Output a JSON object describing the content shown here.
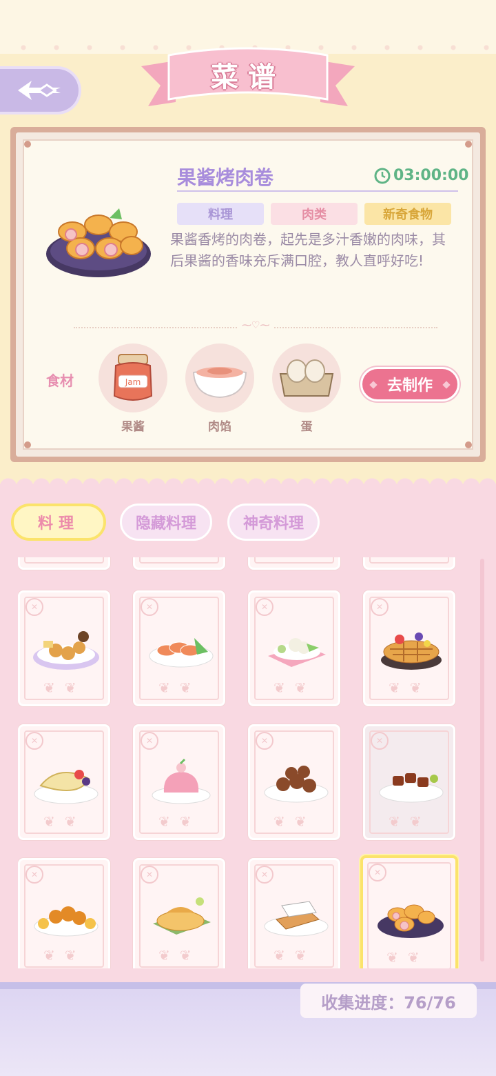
{
  "header": {
    "title": "菜谱",
    "back_icon": "back-arrow-icon"
  },
  "detail": {
    "dish_name": "果酱烤肉卷",
    "timer": "03:00:00",
    "tags": [
      "料理",
      "肉类",
      "新奇食物"
    ],
    "description": "果酱香烤的肉卷，起先是多汁香嫩的肉味，其后果酱的香味充斥满口腔，教人直呼好吃!",
    "ingredients_label": "食材",
    "ingredients": [
      {
        "name": "果酱",
        "icon": "jam-jar-icon",
        "jar_text": "Jam"
      },
      {
        "name": "肉馅",
        "icon": "meat-filling-icon"
      },
      {
        "name": "蛋",
        "icon": "egg-carton-icon"
      }
    ],
    "make_button": "去制作"
  },
  "tabs": [
    "料理",
    "隐藏料理",
    "神奇料理"
  ],
  "active_tab": "料理",
  "recipe_cards": [
    {
      "icon": "nuggets-platter-icon"
    },
    {
      "icon": "salmon-sashimi-icon"
    },
    {
      "icon": "cauliflower-salad-icon"
    },
    {
      "icon": "fruit-pie-icon"
    },
    {
      "icon": "taco-icon"
    },
    {
      "icon": "pink-jelly-icon"
    },
    {
      "icon": "meatballs-icon"
    },
    {
      "icon": "braised-pork-icon"
    },
    {
      "icon": "orange-chicken-icon"
    },
    {
      "icon": "fish-pie-icon"
    },
    {
      "icon": "toast-icon"
    },
    {
      "icon": "meat-roll-icon",
      "selected": true
    }
  ],
  "footer": {
    "progress_label": "收集进度：76/76"
  },
  "colors": {
    "accent_pink": "#ec7390",
    "lavender": "#a88ddc",
    "timer_green": "#5fb486",
    "tab_yellow": "#fbe36b"
  }
}
